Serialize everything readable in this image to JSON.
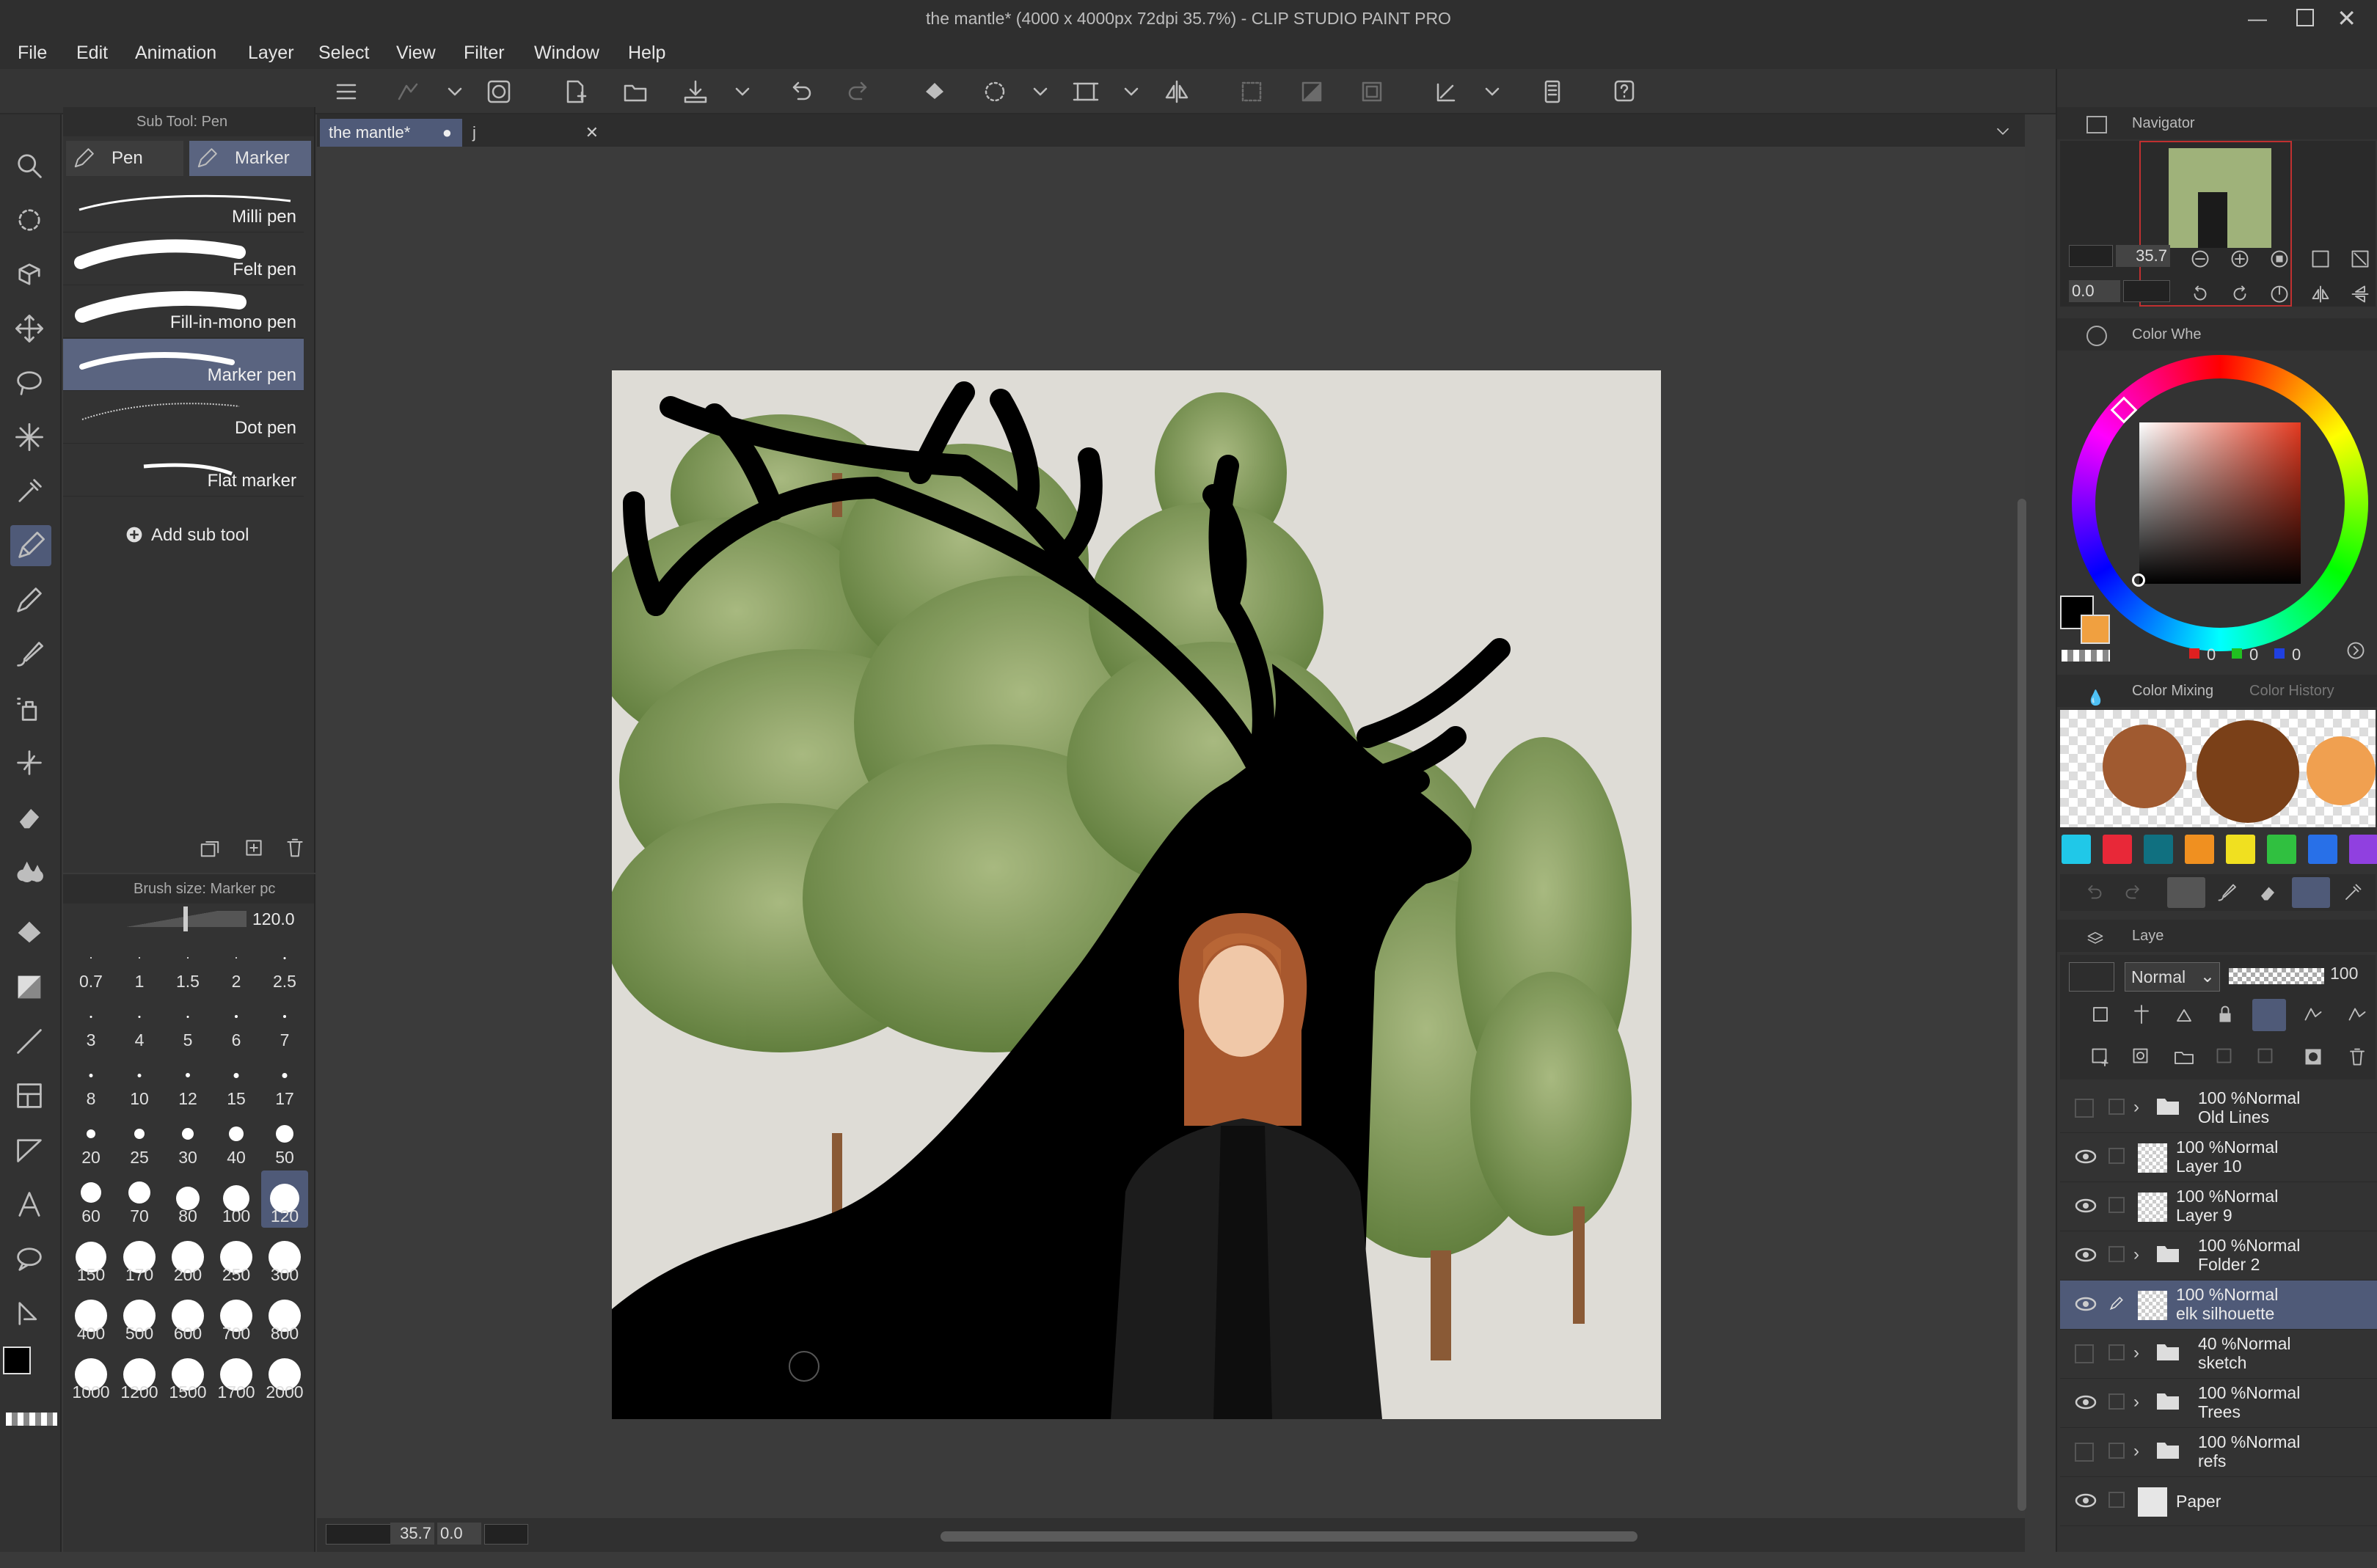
{
  "window": {
    "title": "the mantle* (4000 x 4000px 72dpi 35.7%)  - CLIP STUDIO PAINT PRO"
  },
  "menu": [
    "File",
    "Edit",
    "Animation",
    "Layer",
    "Select",
    "View",
    "Filter",
    "Window",
    "Help"
  ],
  "document_tabs": [
    {
      "label": "the mantle*",
      "active": true
    },
    {
      "label": "j",
      "active": false
    }
  ],
  "subtool": {
    "panel_title": "Sub Tool: Pen",
    "tabs": [
      "Pen",
      "Marker"
    ],
    "active_tab": "Marker",
    "brushes": [
      {
        "name": "Milli pen",
        "selected": false
      },
      {
        "name": "Felt pen",
        "selected": false
      },
      {
        "name": "Fill-in-mono pen",
        "selected": false
      },
      {
        "name": "Marker pen",
        "selected": true
      },
      {
        "name": "Dot pen",
        "selected": false
      },
      {
        "name": "Flat marker",
        "selected": false
      }
    ],
    "add_label": "Add sub tool"
  },
  "brush_size": {
    "panel_title": "Brush size: Marker pc",
    "value": "120.0",
    "presets": [
      "0.7",
      "1",
      "1.5",
      "2",
      "2.5",
      "3",
      "4",
      "5",
      "6",
      "7",
      "8",
      "10",
      "12",
      "15",
      "17",
      "20",
      "25",
      "30",
      "40",
      "50",
      "60",
      "70",
      "80",
      "100",
      "120",
      "150",
      "170",
      "200",
      "250",
      "300",
      "400",
      "500",
      "600",
      "700",
      "800",
      "1000",
      "1200",
      "1500",
      "1700",
      "2000"
    ],
    "selected": "120"
  },
  "navigator": {
    "title": "Navigator",
    "zoom": "35.7",
    "rotation": "0.0"
  },
  "color_wheel": {
    "title": "Color Whe",
    "rgb": [
      "0",
      "0",
      "0"
    ],
    "main_color": "#000000",
    "sub_color": "#f0a040"
  },
  "color_mixing": {
    "tabs": [
      "Color Mixing",
      "Color History"
    ]
  },
  "palette": [
    "#20c8e8",
    "#e82838",
    "#107080",
    "#f09020",
    "#f0e020",
    "#30c040",
    "#2870e8",
    "#9040e0"
  ],
  "layers": {
    "title": "Laye",
    "blend_mode": "Normal",
    "opacity": "100",
    "items": [
      {
        "mode": "100 %Normal",
        "name": "Old Lines",
        "type": "folder",
        "visible": false,
        "selected": false
      },
      {
        "mode": "100 %Normal",
        "name": "Layer 10",
        "type": "raster",
        "visible": true,
        "selected": false
      },
      {
        "mode": "100 %Normal",
        "name": "Layer 9",
        "type": "raster",
        "visible": true,
        "selected": false
      },
      {
        "mode": "100 %Normal",
        "name": "Folder 2",
        "type": "folder",
        "visible": true,
        "selected": false
      },
      {
        "mode": "100 %Normal",
        "name": "elk silhouette",
        "type": "raster",
        "visible": true,
        "selected": true
      },
      {
        "mode": "40 %Normal",
        "name": "sketch",
        "type": "folder",
        "visible": false,
        "selected": false
      },
      {
        "mode": "100 %Normal",
        "name": "Trees",
        "type": "folder",
        "visible": true,
        "selected": false
      },
      {
        "mode": "100 %Normal",
        "name": "refs",
        "type": "folder",
        "visible": false,
        "selected": false
      },
      {
        "mode": "",
        "name": "Paper",
        "type": "paper",
        "visible": true,
        "selected": false
      }
    ]
  },
  "status": {
    "zoom": "35.7",
    "angle": "0.0"
  }
}
